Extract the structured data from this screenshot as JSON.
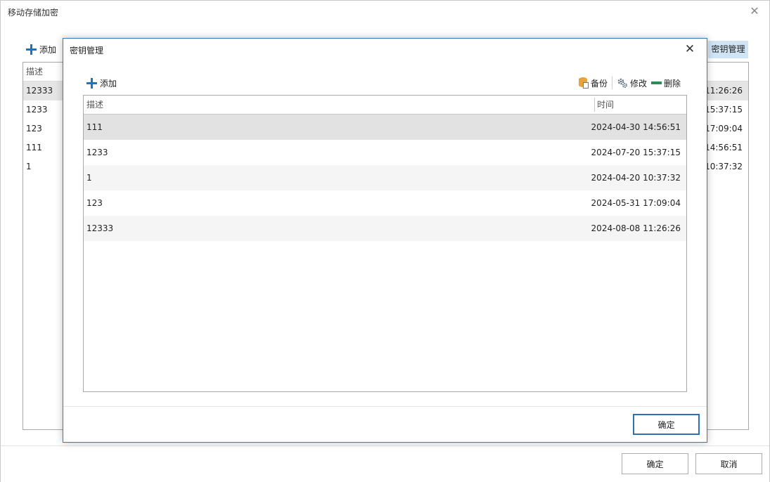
{
  "outer": {
    "title": "移动存储加密",
    "add_label": "添加",
    "keymgr_label": "密钥管理",
    "column_desc": "描述",
    "rows": [
      {
        "desc": "12333",
        "time": "11:26:26"
      },
      {
        "desc": "1233",
        "time": "15:37:15"
      },
      {
        "desc": "123",
        "time": "17:09:04"
      },
      {
        "desc": "111",
        "time": "14:56:51"
      },
      {
        "desc": "1",
        "time": "10:37:32"
      }
    ],
    "ok_label": "确定",
    "cancel_label": "取消"
  },
  "modal": {
    "title": "密钥管理",
    "add_label": "添加",
    "backup_label": "备份",
    "edit_label": "修改",
    "delete_label": "删除",
    "columns": {
      "desc": "描述",
      "time": "时间"
    },
    "rows": [
      {
        "desc": "111",
        "time": "2024-04-30 14:56:51"
      },
      {
        "desc": "1233",
        "time": "2024-07-20 15:37:15"
      },
      {
        "desc": "1",
        "time": "2024-04-20 10:37:32"
      },
      {
        "desc": "123",
        "time": "2024-05-31 17:09:04"
      },
      {
        "desc": "12333",
        "time": "2024-08-08 11:26:26"
      }
    ],
    "ok_label": "确定"
  },
  "colors": {
    "accent": "#1a73c6",
    "selected_row": "#e2e2e2",
    "keymgr_highlight": "#cfe4f5"
  }
}
